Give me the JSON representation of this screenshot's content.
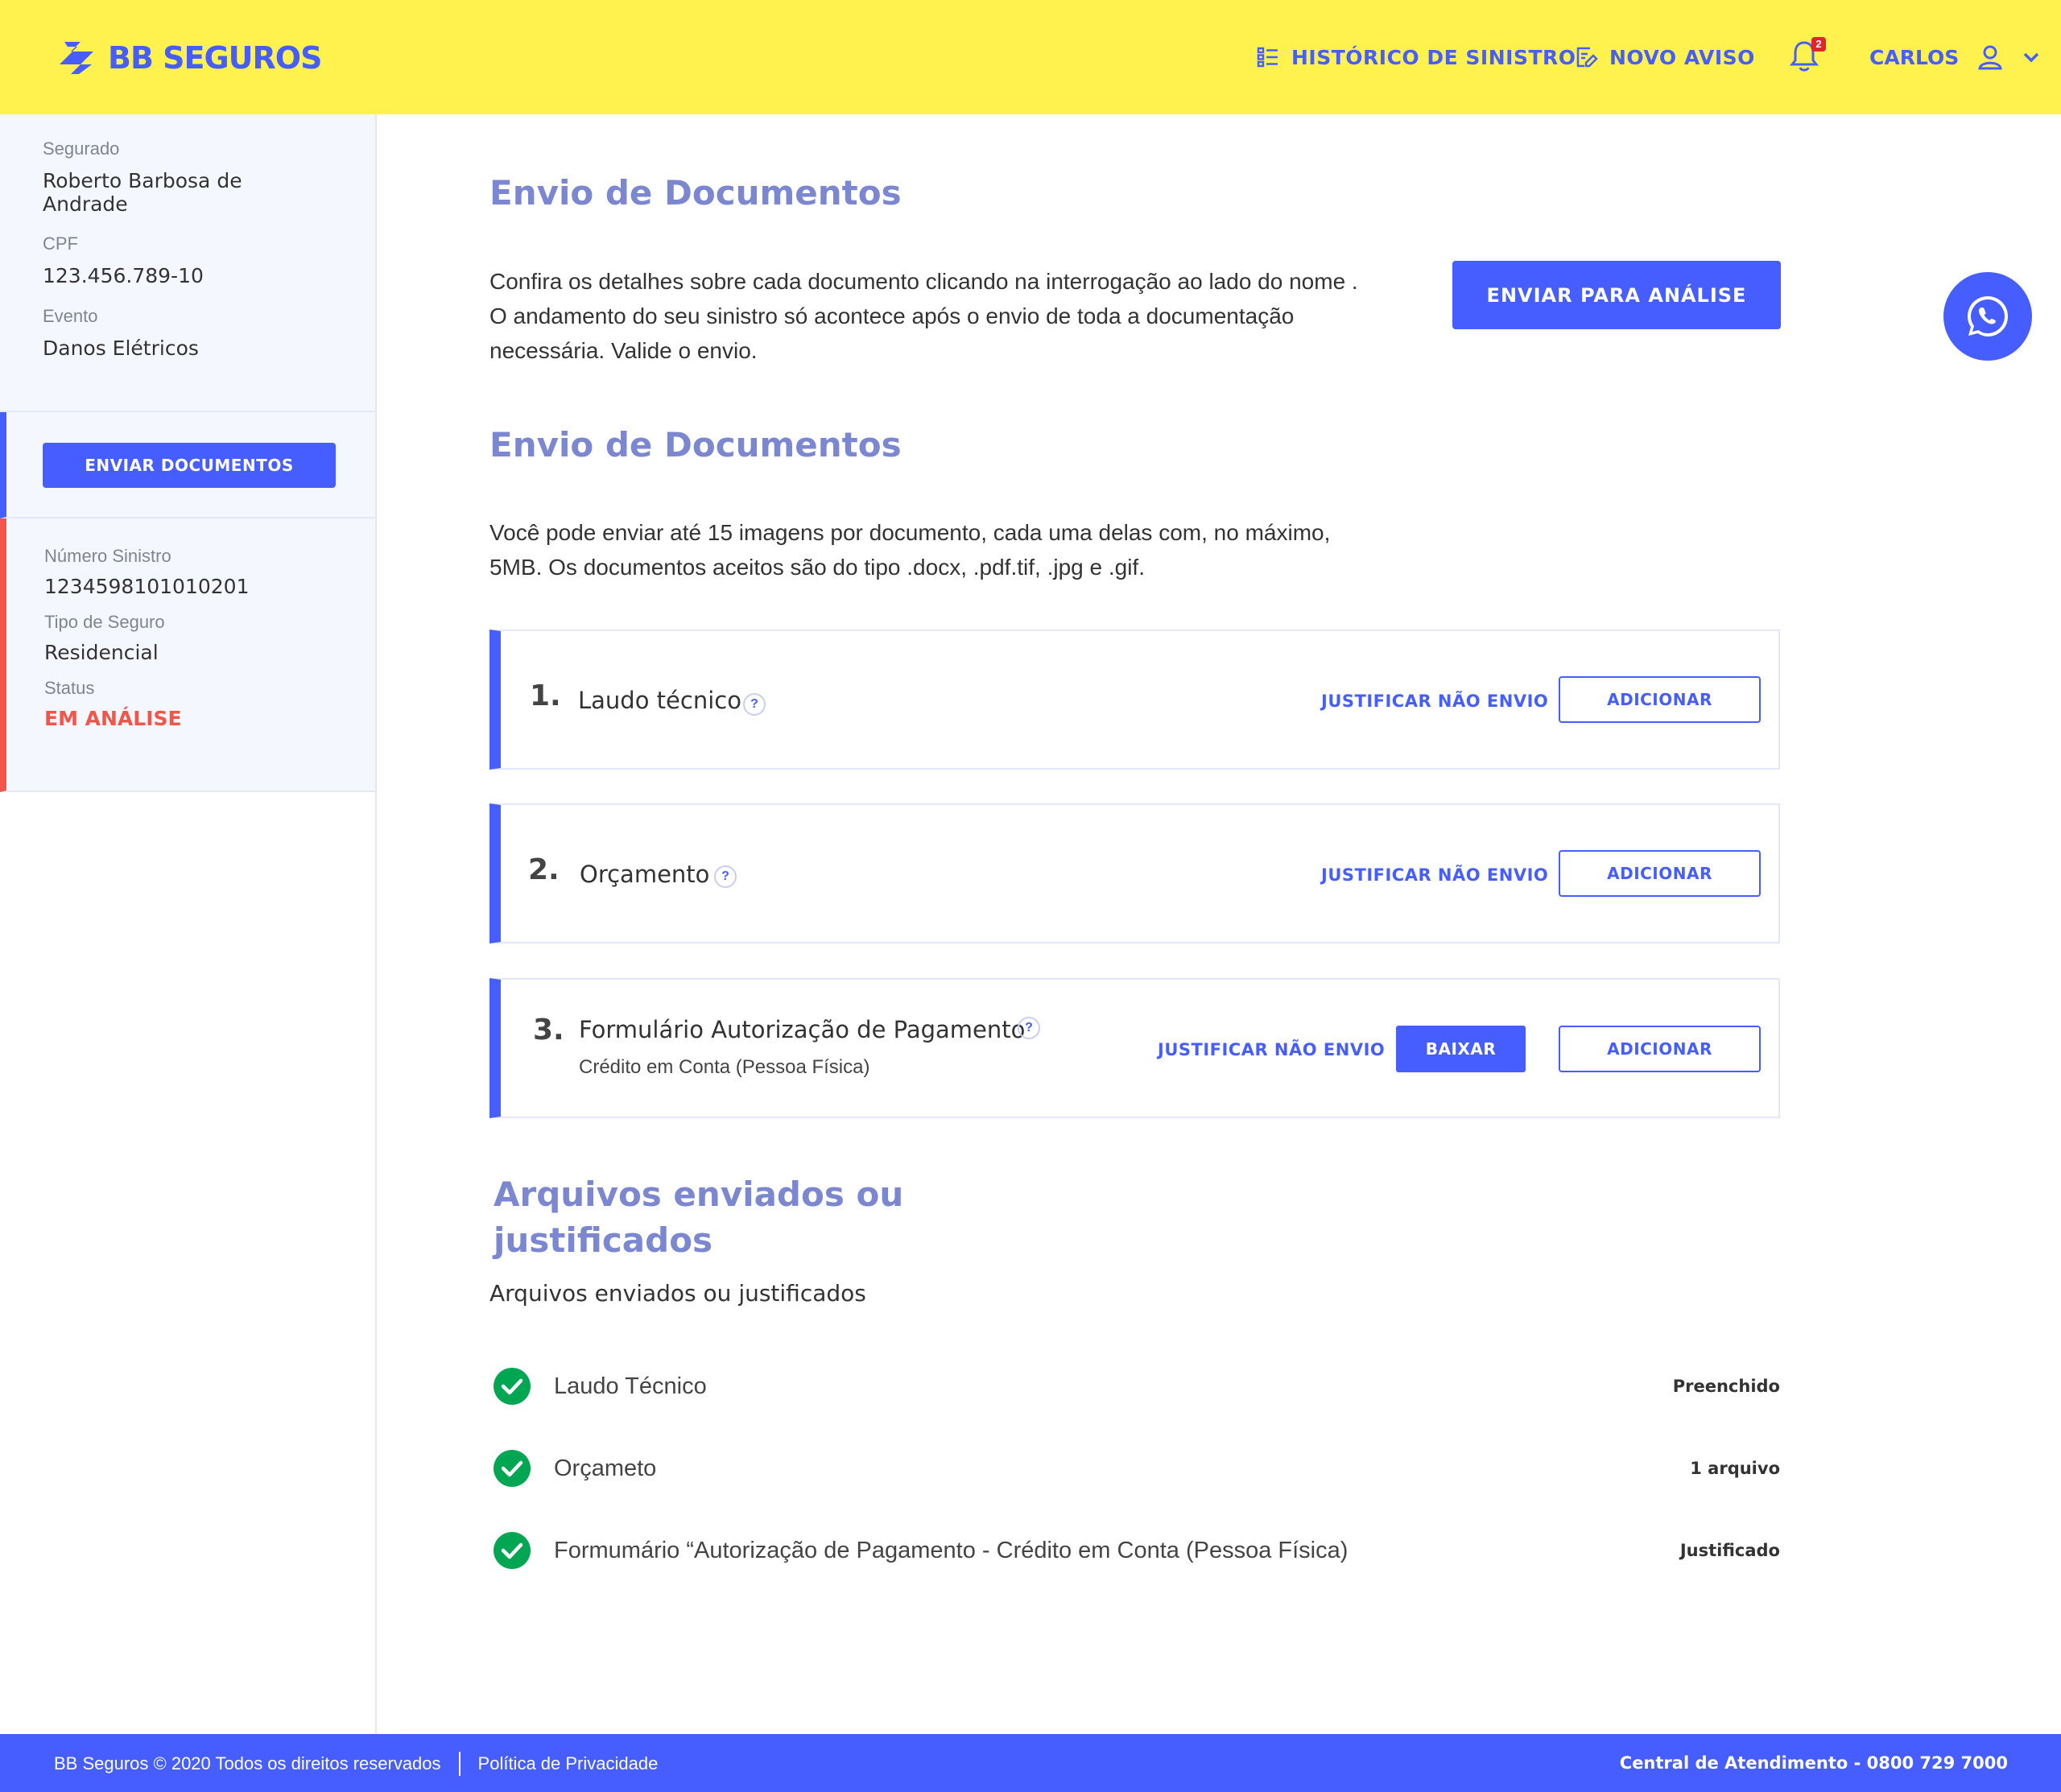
{
  "header": {
    "logo_text": "BB SEGUROS",
    "nav_historico": "HISTÓRICO DE SINISTRO",
    "nav_novo_aviso": "NOVO AVISO",
    "notifications_count": "2",
    "user_name": "CARLOS",
    "brand_color": "#465eff",
    "background_color": "#fff24f"
  },
  "sidebar": {
    "segurado_label": "Segurado",
    "segurado_value": "Roberto Barbosa de Andrade",
    "cpf_label": "CPF",
    "cpf_value": "123.456.789-10",
    "evento_label": "Evento",
    "evento_value": "Danos Elétricos",
    "enviar_documentos_button": "ENVIAR DOCUMENTOS",
    "numero_sinistro_label": "Número Sinistro",
    "numero_sinistro_value": "1234598101010201",
    "tipo_seguro_label": "Tipo de Seguro",
    "tipo_seguro_value": "Residencial",
    "status_label": "Status",
    "status_value": "EM ANÁLISE"
  },
  "main": {
    "title1": "Envio de Documentos",
    "intro_line1": "Confira os detalhes sobre cada documento clicando na interrogação ao lado do nome .",
    "intro_line2": "O andamento do seu sinistro só acontece após o envio de toda a documentação",
    "intro_line3": "necessária. Valide o envio.",
    "enviar_analise_button": "ENVIAR PARA ANÁLISE",
    "title2": "Envio de Documentos",
    "info_line1": "Você pode enviar até 15 imagens por documento, cada uma delas com, no máximo,",
    "info_line2": "5MB. Os documentos aceitos são do tipo .docx, .pdf.tif, .jpg e .gif.",
    "documents": [
      {
        "number": "1.",
        "title": "Laudo técnico",
        "help": "?",
        "justify": "JUSTIFICAR NÃO ENVIO",
        "add": "ADICIONAR"
      },
      {
        "number": "2.",
        "title": "Orçamento",
        "help": "?",
        "justify": "JUSTIFICAR NÃO ENVIO",
        "add": "ADICIONAR"
      },
      {
        "number": "3.",
        "title": "Formulário Autorização de Pagamento",
        "subtitle": "Crédito em Conta (Pessoa Física)",
        "help": "?",
        "justify": "JUSTIFICAR NÃO ENVIO",
        "download": "BAIXAR",
        "add": "ADICIONAR"
      }
    ],
    "sent_title": "Arquivos enviados ou justificados",
    "sent_subtitle": "Arquivos enviados ou justificados",
    "files": [
      {
        "name": "Laudo Técnico",
        "status": "Preenchido"
      },
      {
        "name": "Orçameto",
        "status": "1 arquivo"
      },
      {
        "name": "Formumário “Autorização de Pagamento - Crédito em Conta (Pessoa Física)",
        "status": "Justificado"
      }
    ]
  },
  "footer": {
    "copyright": "BB Seguros © 2020 Todos os direitos reservados",
    "privacy": "Política de Privacidade",
    "central": "Central de Atendimento - 0800 729 7000"
  },
  "icons": [
    "bb-logo-icon",
    "list-icon",
    "edit-document-icon",
    "bell-icon",
    "user-icon",
    "chevron-down-icon",
    "help-icon",
    "check-circle-icon",
    "whatsapp-icon"
  ],
  "colors": {
    "accent": "#465eff",
    "heading": "#7b87d1",
    "status_alert": "#f2564a",
    "success": "#00a651"
  }
}
